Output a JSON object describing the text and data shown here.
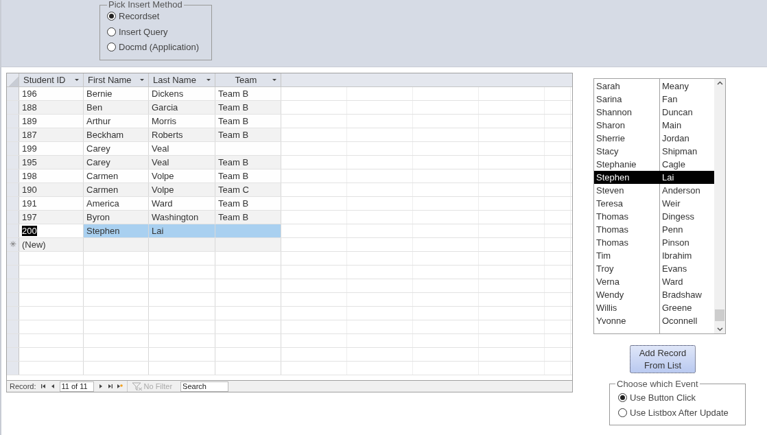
{
  "insert_method": {
    "title": "Pick Insert Method",
    "options": [
      {
        "label": "Recordset",
        "selected": true
      },
      {
        "label": "Insert Query",
        "selected": false
      },
      {
        "label": "Docmd (Application)",
        "selected": false
      }
    ]
  },
  "datasheet": {
    "columns": [
      "Student ID",
      "First Name",
      "Last Name",
      "Team"
    ],
    "rows": [
      {
        "cells": [
          "196",
          "Bernie",
          "Dickens",
          "Team B"
        ],
        "selected": false
      },
      {
        "cells": [
          "188",
          "Ben",
          "Garcia",
          "Team B"
        ],
        "selected": false
      },
      {
        "cells": [
          "189",
          "Arthur",
          "Morris",
          "Team B"
        ],
        "selected": false
      },
      {
        "cells": [
          "187",
          "Beckham",
          "Roberts",
          "Team B"
        ],
        "selected": false
      },
      {
        "cells": [
          "199",
          "Carey",
          "Veal",
          ""
        ],
        "selected": false
      },
      {
        "cells": [
          "195",
          "Carey",
          "Veal",
          "Team B"
        ],
        "selected": false
      },
      {
        "cells": [
          "198",
          "Carmen",
          "Volpe",
          "Team B"
        ],
        "selected": false
      },
      {
        "cells": [
          "190",
          "Carmen",
          "Volpe",
          "Team C"
        ],
        "selected": false
      },
      {
        "cells": [
          "191",
          "America",
          "Ward",
          "Team B"
        ],
        "selected": false
      },
      {
        "cells": [
          "197",
          "Byron",
          "Washington",
          "Team B"
        ],
        "selected": false
      },
      {
        "cells": [
          "200",
          "Stephen",
          "Lai",
          ""
        ],
        "selected": true
      }
    ],
    "new_row": {
      "marker": "✳",
      "label": "(New)"
    },
    "navigation": {
      "label": "Record:",
      "position": "11 of 11",
      "filter": "No Filter",
      "search": "Search"
    }
  },
  "listbox": {
    "rows": [
      {
        "cells": [
          "Sarah",
          "Meany"
        ],
        "selected": false
      },
      {
        "cells": [
          "Sarina",
          "Fan"
        ],
        "selected": false
      },
      {
        "cells": [
          "Shannon",
          "Duncan"
        ],
        "selected": false
      },
      {
        "cells": [
          "Sharon",
          "Main"
        ],
        "selected": false
      },
      {
        "cells": [
          "Sherrie",
          "Jordan"
        ],
        "selected": false
      },
      {
        "cells": [
          "Stacy",
          "Shipman"
        ],
        "selected": false
      },
      {
        "cells": [
          "Stephanie",
          "Cagle"
        ],
        "selected": false
      },
      {
        "cells": [
          "Stephen",
          "Lai"
        ],
        "selected": true
      },
      {
        "cells": [
          "Steven",
          "Anderson"
        ],
        "selected": false
      },
      {
        "cells": [
          "Teresa",
          "Weir"
        ],
        "selected": false
      },
      {
        "cells": [
          "Thomas",
          "Dingess"
        ],
        "selected": false
      },
      {
        "cells": [
          "Thomas",
          "Penn"
        ],
        "selected": false
      },
      {
        "cells": [
          "Thomas",
          "Pinson"
        ],
        "selected": false
      },
      {
        "cells": [
          "Tim",
          "Ibrahim"
        ],
        "selected": false
      },
      {
        "cells": [
          "Troy",
          "Evans"
        ],
        "selected": false
      },
      {
        "cells": [
          "Verna",
          "Ward"
        ],
        "selected": false
      },
      {
        "cells": [
          "Wendy",
          "Bradshaw"
        ],
        "selected": false
      },
      {
        "cells": [
          "Willis",
          "Greene"
        ],
        "selected": false
      },
      {
        "cells": [
          "Yvonne",
          "Oconnell"
        ],
        "selected": false
      }
    ]
  },
  "add_button": {
    "label": "Add Record From List"
  },
  "event_choice": {
    "title": "Choose which Event",
    "options": [
      {
        "label": "Use Button Click",
        "selected": true
      },
      {
        "label": "Use Listbox After Update",
        "selected": false
      }
    ]
  }
}
